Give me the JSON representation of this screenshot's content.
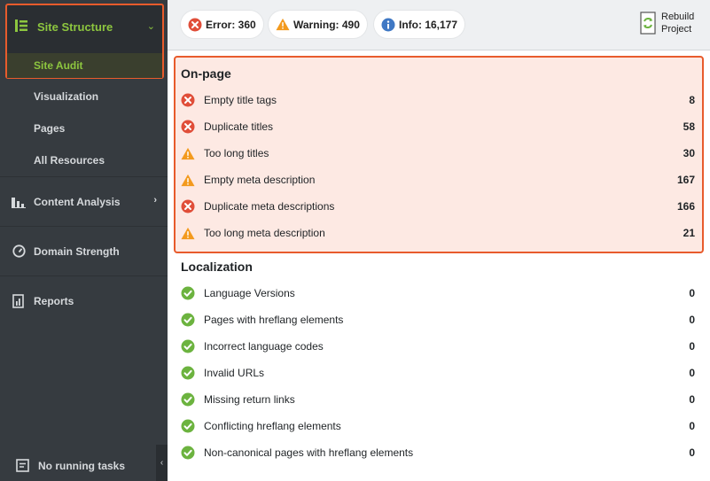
{
  "sidebar": {
    "site_structure": "Site Structure",
    "site_audit": "Site Audit",
    "visualization": "Visualization",
    "pages": "Pages",
    "all_resources": "All Resources",
    "content_analysis": "Content Analysis",
    "domain_strength": "Domain Strength",
    "reports": "Reports",
    "no_running_tasks": "No running tasks"
  },
  "summary": {
    "error": "Error: 360",
    "warning": "Warning: 490",
    "info": "Info: 16,177",
    "rebuild_line1": "Rebuild",
    "rebuild_line2": "Project"
  },
  "onpage": {
    "title": "On-page",
    "rows": [
      {
        "status": "error",
        "icon": "error-icon",
        "name": "Empty title tags",
        "value": "8"
      },
      {
        "status": "error",
        "icon": "error-icon",
        "name": "Duplicate titles",
        "value": "58"
      },
      {
        "status": "warning",
        "icon": "warning-icon",
        "name": "Too long titles",
        "value": "30"
      },
      {
        "status": "warning",
        "icon": "warning-icon",
        "name": "Empty meta description",
        "value": "167"
      },
      {
        "status": "error",
        "icon": "error-icon",
        "name": "Duplicate meta descriptions",
        "value": "166"
      },
      {
        "status": "warning",
        "icon": "warning-icon",
        "name": "Too long meta description",
        "value": "21"
      }
    ]
  },
  "localization": {
    "title": "Localization",
    "rows": [
      {
        "status": "ok",
        "icon": "check-icon",
        "name": "Language Versions",
        "value": "0"
      },
      {
        "status": "ok",
        "icon": "check-icon",
        "name": "Pages with hreflang elements",
        "value": "0"
      },
      {
        "status": "ok",
        "icon": "check-icon",
        "name": "Incorrect language codes",
        "value": "0"
      },
      {
        "status": "ok",
        "icon": "check-icon",
        "name": "Invalid URLs",
        "value": "0"
      },
      {
        "status": "ok",
        "icon": "check-icon",
        "name": "Missing return links",
        "value": "0"
      },
      {
        "status": "ok",
        "icon": "check-icon",
        "name": "Conflicting hreflang elements",
        "value": "0"
      },
      {
        "status": "ok",
        "icon": "check-icon",
        "name": "Non-canonical pages with hreflang elements",
        "value": "0"
      }
    ]
  },
  "colors": {
    "error": "#e04e39",
    "warning": "#f39a1e",
    "ok": "#6cb33f",
    "info": "#3f78c4",
    "accent_green": "#8dc63f",
    "highlight_border": "#e85b2c"
  }
}
